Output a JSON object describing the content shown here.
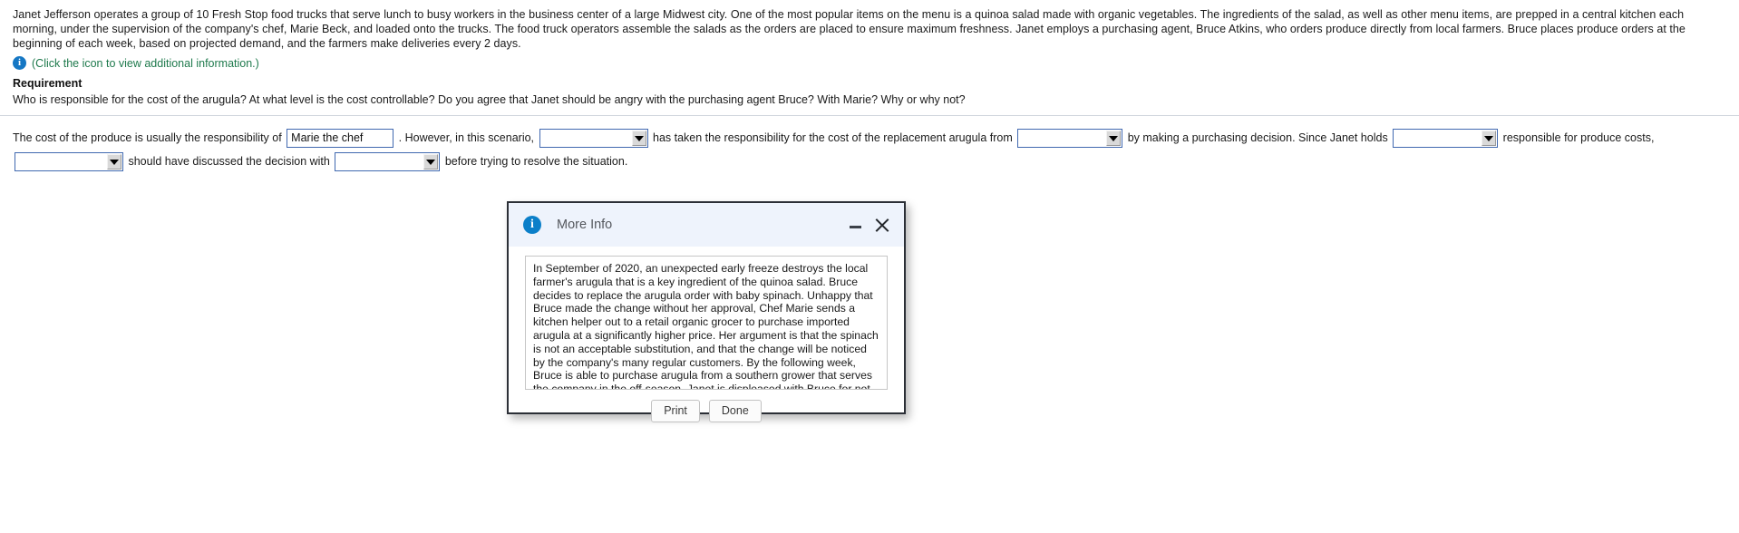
{
  "problem": {
    "paragraph": "Janet Jefferson operates a group of 10 Fresh Stop food trucks that serve lunch to busy workers in the business center of a large Midwest city. One of the most popular items on the menu is a quinoa salad made with organic vegetables. The ingredients of the salad, as well as other menu items, are prepped in a central kitchen each morning, under the supervision of the company's chef, Marie Beck, and loaded onto the trucks. The food truck operators assemble the salads as the orders are placed to ensure maximum freshness. Janet employs a purchasing agent, Bruce Atkins, who orders produce directly from local farmers. Bruce places produce orders at the beginning of each week, based on projected demand, and the farmers make deliveries every 2 days.",
    "info_icon": "info-circle-icon",
    "info_link_text": "(Click the icon to view additional information.)",
    "requirement_heading": "Requirement",
    "requirement_text": "Who is responsible for the cost of the arugula? At what level is the cost controllable? Do you agree that Janet should be angry with the purchasing agent Bruce? With Marie? Why or why not?"
  },
  "answer": {
    "t1": "The cost of the produce is usually the responsibility of",
    "f1_value": "Marie the chef",
    "t2": ". However, in this scenario,",
    "f2_value": "",
    "t3": "has taken the responsibility for the cost of the replacement arugula from",
    "f3_value": "",
    "t4": "by making a purchasing decision. Since Janet holds",
    "f4_value": "",
    "t5": "responsible for produce costs,",
    "f5_value": "",
    "t6": "should have discussed the decision with",
    "f6_value": "",
    "t7": "before trying to resolve the situation."
  },
  "dialog": {
    "icon": "info-circle-icon",
    "title": "More Info",
    "minimize_label": "minimize",
    "close_label": "close",
    "body_text": "In September of 2020, an unexpected early freeze destroys the local farmer's arugula that is a key ingredient of the quinoa salad. Bruce decides to replace the arugula order with baby spinach. Unhappy that Bruce made the change without her approval, Chef Marie sends a kitchen helper out to a retail organic grocer to purchase imported arugula at a significantly higher price. Her argument is that the spinach is not an acceptable substitution, and that the change will be noticed by the company's many regular customers. By the following week, Bruce is able to purchase arugula from a southern grower that serves the company in the off-season. Janet is displeased with Bruce for not securing replacement wholesale arugula in time to avoid the substitution, and with Marie for making the unauthorized purchase at the much higher price.",
    "print_label": "Print",
    "done_label": "Done"
  },
  "colors": {
    "info_icon_blue": "#1577c4",
    "info_link_green": "#1f7a4d",
    "field_border_blue": "#4169b0",
    "dialog_header_blue": "#eef3fc",
    "dialog_border": "#2b2f36"
  }
}
